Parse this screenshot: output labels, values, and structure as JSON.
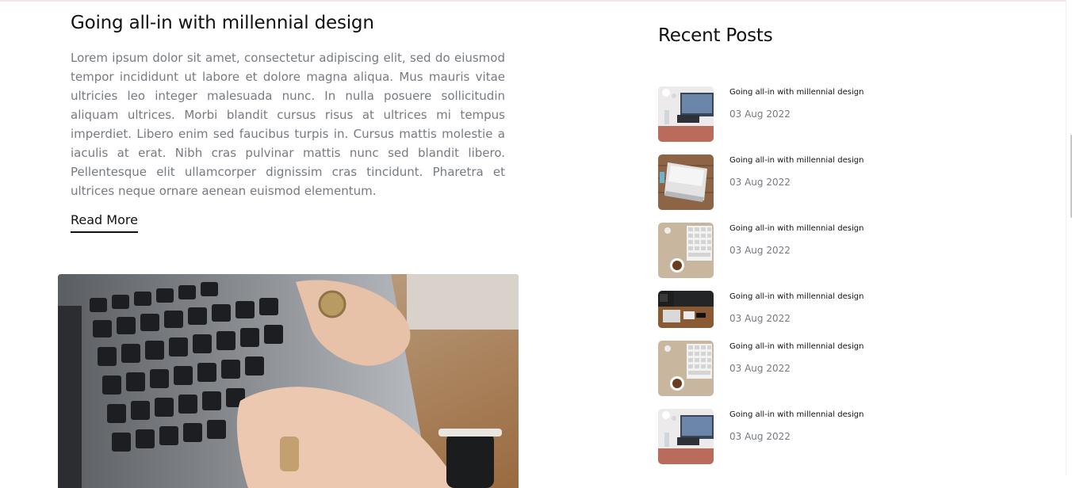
{
  "post": {
    "title": "Going all-in with millennial design",
    "excerpt": "Lorem ipsum dolor sit amet, consectetur adipiscing elit, sed do eiusmod tempor incididunt ut labore et dolore magna aliqua. Mus mauris vitae ultricies leo integer malesuada nunc. In nulla posuere sollicitudin aliquam ultrices. Morbi blandit cursus risus at ultrices mi tempus imperdiet. Libero enim sed faucibus turpis in. Cursus mattis molestie a iaculis at erat. Nibh cras pulvinar mattis nunc sed blandit libero. Pellentesque elit ullamcorper dignissim cras tincidunt. Pharetra et ultrices neque ornare aenean euismod elementum.",
    "read_more": "Read More"
  },
  "sidebar": {
    "title": "Recent Posts",
    "items": [
      {
        "title": "Going all-in with millennial design",
        "date": "03 Aug 2022"
      },
      {
        "title": "Going all-in with millennial design",
        "date": "03 Aug 2022"
      },
      {
        "title": "Going all-in with millennial design",
        "date": "03 Aug 2022"
      },
      {
        "title": "Going all-in with millennial design",
        "date": "03 Aug 2022"
      },
      {
        "title": "Going all-in with millennial design",
        "date": "03 Aug 2022"
      },
      {
        "title": "Going all-in with millennial design",
        "date": "03 Aug 2022"
      }
    ]
  },
  "colors": {
    "text": "#111111",
    "muted": "#767b82",
    "accent_rule": "#f6e3e6"
  }
}
